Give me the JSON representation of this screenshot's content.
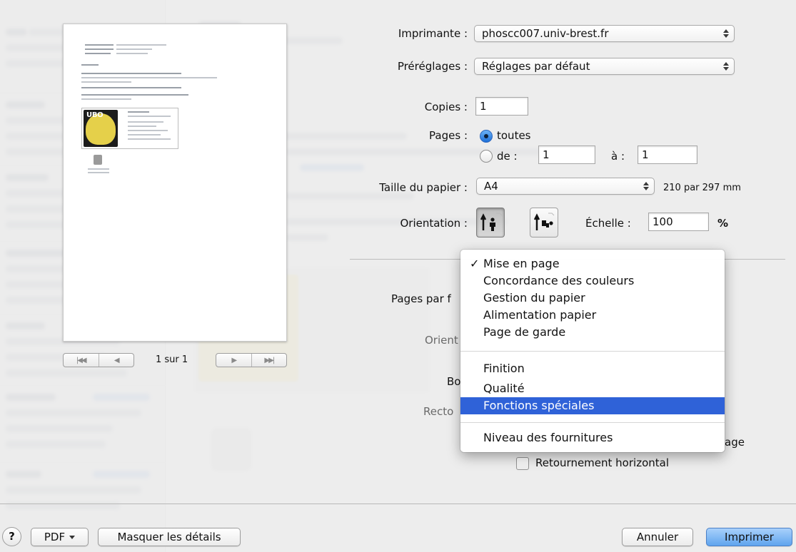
{
  "preview": {
    "page_count": "1 sur 1",
    "signature_logo_text": "UBO"
  },
  "settings": {
    "printer": {
      "label": "Imprimante :",
      "value": "phoscc007.univ-brest.fr"
    },
    "presets": {
      "label": "Préréglages :",
      "value": "Réglages par défaut"
    },
    "copies": {
      "label": "Copies :",
      "value": "1"
    },
    "pages": {
      "label": "Pages :",
      "option_all": "toutes",
      "option_range": "de :",
      "from": "1",
      "to_label": "à :",
      "to": "1"
    },
    "paper_size": {
      "label": "Taille du papier :",
      "value": "A4",
      "dimensions": "210 par 297 mm"
    },
    "orientation": {
      "label": "Orientation :"
    },
    "scale": {
      "label": "Échelle :",
      "value": "100",
      "unit": "%"
    }
  },
  "background_form": {
    "pages_per_sheet_label": "Pages par f",
    "orientation_label": "Orient",
    "border_label": "Bo",
    "two_sided_label": "Recto",
    "reverse_orientation_tail": "age",
    "flip_horizontal_label": "Retournement horizontal"
  },
  "menu": {
    "items_group1": [
      "Mise en page",
      "Concordance des couleurs",
      "Gestion du papier",
      "Alimentation papier",
      "Page de garde"
    ],
    "items_group2": [
      "Finition",
      "Qualité",
      "Fonctions spéciales"
    ],
    "items_group3": [
      "Niveau des fournitures"
    ],
    "checked_item": "Mise en page",
    "highlighted_item": "Fonctions spéciales"
  },
  "footer": {
    "help": "?",
    "pdf": "PDF",
    "hide_details": "Masquer les détails",
    "cancel": "Annuler",
    "print": "Imprimer"
  },
  "colors": {
    "highlight": "#2f62d8",
    "default_button": "#5fa4ee"
  }
}
